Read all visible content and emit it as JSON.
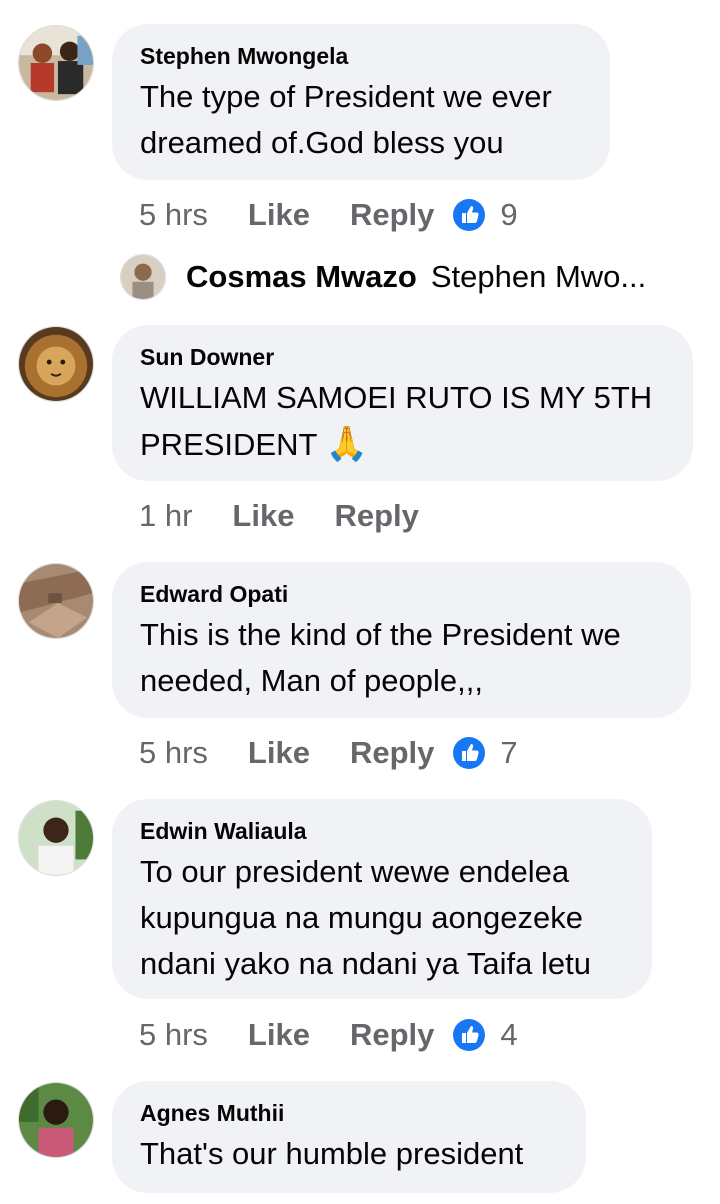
{
  "comments": [
    {
      "author": "Stephen Mwongela",
      "text_lines": [
        "The type of President we ever",
        "dreamed of.God bless you"
      ],
      "time": "5 hrs",
      "like_label": "Like",
      "reply_label": "Reply",
      "reaction_count": "9"
    },
    {
      "author": "Sun Downer",
      "text_lines": [
        "WILLIAM SAMOEI RUTO IS MY 5TH",
        "PRESIDENT"
      ],
      "emoji": "🙏",
      "time": "1 hr",
      "like_label": "Like",
      "reply_label": "Reply"
    },
    {
      "author": "Edward Opati",
      "text_lines": [
        "This is the kind of the President we",
        "needed, Man of people,,,"
      ],
      "time": "5 hrs",
      "like_label": "Like",
      "reply_label": "Reply",
      "reaction_count": "7"
    },
    {
      "author": "Edwin Waliaula",
      "text_lines": [
        "To our president wewe endelea",
        "kupungua na mungu aongezeke",
        "ndani yako na ndani ya Taifa letu"
      ],
      "time": "5 hrs",
      "like_label": "Like",
      "reply_label": "Reply",
      "reaction_count": "4"
    },
    {
      "author": "Agnes Muthii",
      "text_lines": [
        "That's our humble president"
      ]
    }
  ],
  "reply_preview": {
    "author": "Cosmas Mwazo",
    "text": "Stephen Mwo..."
  },
  "icons": {
    "reaction": "like-thumb-icon"
  },
  "colors": {
    "bubble": "#f0f2f5",
    "meta": "#65676b",
    "like_blue": "#1877f2"
  }
}
